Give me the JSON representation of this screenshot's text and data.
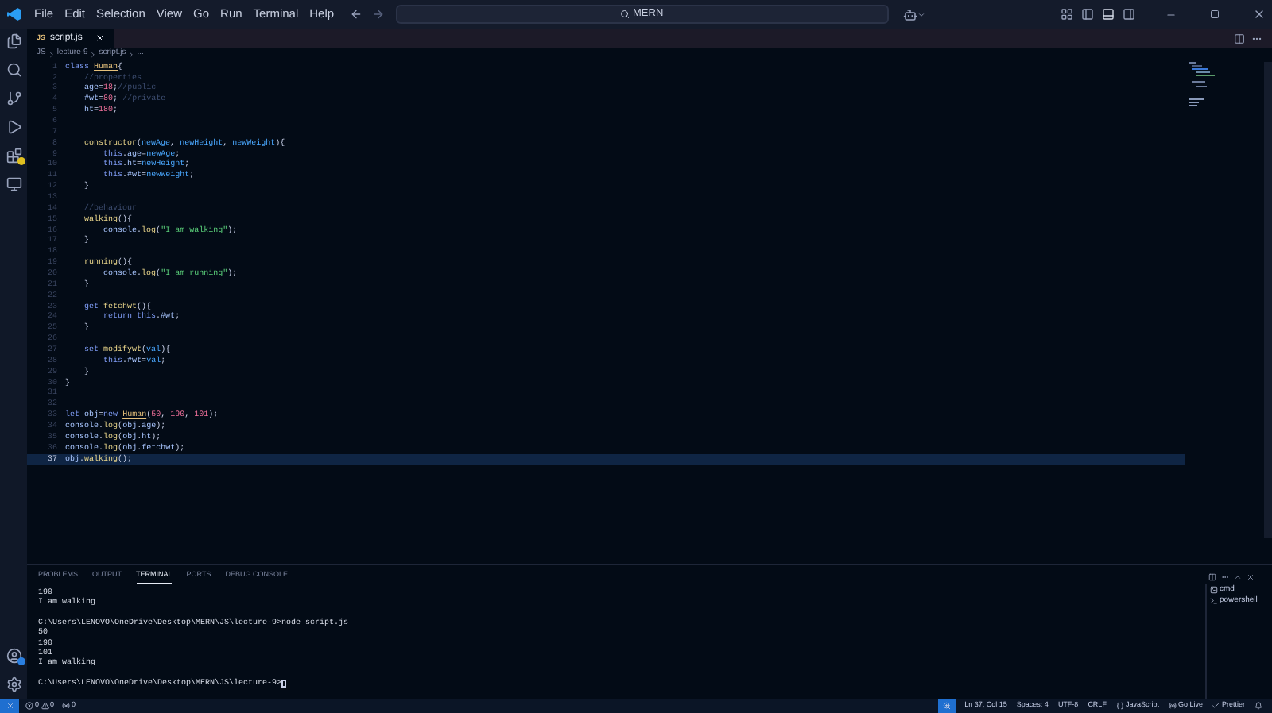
{
  "menu": [
    "File",
    "Edit",
    "Selection",
    "View",
    "Go",
    "Run",
    "Terminal",
    "Help"
  ],
  "search": {
    "value": "MERN"
  },
  "tabs": [
    {
      "icon": "JS",
      "label": "script.js",
      "selected": true
    }
  ],
  "breadcrumb": [
    "JS",
    "lecture-9",
    "script.js",
    "..."
  ],
  "editor": {
    "lines": [
      {
        "n": "1",
        "current": false,
        "tokens": [
          {
            "t": "class ",
            "kind": "keyword"
          },
          {
            "t": "Human",
            "kind": "classname"
          },
          {
            "t": "{",
            "kind": "punct"
          }
        ]
      },
      {
        "n": "2",
        "current": false,
        "tokens": [
          {
            "t": "    //properties",
            "kind": "comment"
          }
        ]
      },
      {
        "n": "3",
        "current": false,
        "tokens": [
          {
            "t": "    age",
            "kind": "variable"
          },
          {
            "t": "=",
            "kind": "punct"
          },
          {
            "t": "18",
            "kind": "number"
          },
          {
            "t": ";",
            "kind": "punct"
          },
          {
            "t": "//public",
            "kind": "comment"
          }
        ]
      },
      {
        "n": "4",
        "current": false,
        "tokens": [
          {
            "t": "    #wt",
            "kind": "variable"
          },
          {
            "t": "=",
            "kind": "punct"
          },
          {
            "t": "80",
            "kind": "number"
          },
          {
            "t": "; ",
            "kind": "punct"
          },
          {
            "t": "//private",
            "kind": "comment"
          }
        ]
      },
      {
        "n": "5",
        "current": false,
        "tokens": [
          {
            "t": "    ht",
            "kind": "variable"
          },
          {
            "t": "=",
            "kind": "punct"
          },
          {
            "t": "180",
            "kind": "number"
          },
          {
            "t": ";",
            "kind": "punct"
          }
        ]
      },
      {
        "n": "6",
        "current": false
      },
      {
        "n": "7",
        "current": false
      },
      {
        "n": "8",
        "current": false,
        "tokens": [
          {
            "t": "    constructor",
            "kind": "function"
          },
          {
            "t": "(",
            "kind": "punct"
          },
          {
            "t": "newAge",
            "kind": "param"
          },
          {
            "t": ", ",
            "kind": "punct"
          },
          {
            "t": "newHeight",
            "kind": "param"
          },
          {
            "t": ", ",
            "kind": "punct"
          },
          {
            "t": "newWeight",
            "kind": "param"
          },
          {
            "t": "){",
            "kind": "punct"
          }
        ]
      },
      {
        "n": "9",
        "current": false,
        "tokens": [
          {
            "t": "        this",
            "kind": "keyword"
          },
          {
            "t": ".",
            "kind": "punct"
          },
          {
            "t": "age",
            "kind": "variable"
          },
          {
            "t": "=",
            "kind": "punct"
          },
          {
            "t": "newAge",
            "kind": "param"
          },
          {
            "t": ";",
            "kind": "punct"
          }
        ]
      },
      {
        "n": "10",
        "current": false,
        "tokens": [
          {
            "t": "        this",
            "kind": "keyword"
          },
          {
            "t": ".",
            "kind": "punct"
          },
          {
            "t": "ht",
            "kind": "variable"
          },
          {
            "t": "=",
            "kind": "punct"
          },
          {
            "t": "newHeight",
            "kind": "param"
          },
          {
            "t": ";",
            "kind": "punct"
          }
        ]
      },
      {
        "n": "11",
        "current": false,
        "tokens": [
          {
            "t": "        this",
            "kind": "keyword"
          },
          {
            "t": ".",
            "kind": "punct"
          },
          {
            "t": "#wt",
            "kind": "variable"
          },
          {
            "t": "=",
            "kind": "punct"
          },
          {
            "t": "newWeight",
            "kind": "param"
          },
          {
            "t": ";",
            "kind": "punct"
          }
        ]
      },
      {
        "n": "12",
        "current": false,
        "tokens": [
          {
            "t": "    }",
            "kind": "punct"
          }
        ]
      },
      {
        "n": "13",
        "current": false
      },
      {
        "n": "14",
        "current": false,
        "tokens": [
          {
            "t": "    //behaviour",
            "kind": "comment"
          }
        ]
      },
      {
        "n": "15",
        "current": false,
        "tokens": [
          {
            "t": "    walking",
            "kind": "function"
          },
          {
            "t": "(){",
            "kind": "punct"
          }
        ]
      },
      {
        "n": "16",
        "current": false,
        "tokens": [
          {
            "t": "        console",
            "kind": "variable"
          },
          {
            "t": ".",
            "kind": "punct"
          },
          {
            "t": "log",
            "kind": "function"
          },
          {
            "t": "(",
            "kind": "punct"
          },
          {
            "t": "\"I am walking\"",
            "kind": "string"
          },
          {
            "t": ");",
            "kind": "punct"
          }
        ]
      },
      {
        "n": "17",
        "current": false,
        "tokens": [
          {
            "t": "    }",
            "kind": "punct"
          }
        ]
      },
      {
        "n": "18",
        "current": false
      },
      {
        "n": "19",
        "current": false,
        "tokens": [
          {
            "t": "    running",
            "kind": "function"
          },
          {
            "t": "(){",
            "kind": "punct"
          }
        ]
      },
      {
        "n": "20",
        "current": false,
        "tokens": [
          {
            "t": "        console",
            "kind": "variable"
          },
          {
            "t": ".",
            "kind": "punct"
          },
          {
            "t": "log",
            "kind": "function"
          },
          {
            "t": "(",
            "kind": "punct"
          },
          {
            "t": "\"I am running\"",
            "kind": "string"
          },
          {
            "t": ");",
            "kind": "punct"
          }
        ]
      },
      {
        "n": "21",
        "current": false,
        "tokens": [
          {
            "t": "    }",
            "kind": "punct"
          }
        ]
      },
      {
        "n": "22",
        "current": false
      },
      {
        "n": "23",
        "current": false,
        "tokens": [
          {
            "t": "    get ",
            "kind": "keyword"
          },
          {
            "t": "fetchwt",
            "kind": "function"
          },
          {
            "t": "(){",
            "kind": "punct"
          }
        ]
      },
      {
        "n": "24",
        "current": false,
        "tokens": [
          {
            "t": "        return ",
            "kind": "keyword"
          },
          {
            "t": "this",
            "kind": "keyword"
          },
          {
            "t": ".",
            "kind": "punct"
          },
          {
            "t": "#wt",
            "kind": "variable"
          },
          {
            "t": ";",
            "kind": "punct"
          }
        ]
      },
      {
        "n": "25",
        "current": false,
        "tokens": [
          {
            "t": "    }",
            "kind": "punct"
          }
        ]
      },
      {
        "n": "26",
        "current": false
      },
      {
        "n": "27",
        "current": false,
        "tokens": [
          {
            "t": "    set ",
            "kind": "keyword"
          },
          {
            "t": "modifywt",
            "kind": "function"
          },
          {
            "t": "(",
            "kind": "punct"
          },
          {
            "t": "val",
            "kind": "param"
          },
          {
            "t": "){",
            "kind": "punct"
          }
        ]
      },
      {
        "n": "28",
        "current": false,
        "tokens": [
          {
            "t": "        this",
            "kind": "keyword"
          },
          {
            "t": ".",
            "kind": "punct"
          },
          {
            "t": "#wt",
            "kind": "variable"
          },
          {
            "t": "=",
            "kind": "punct"
          },
          {
            "t": "val",
            "kind": "param"
          },
          {
            "t": ";",
            "kind": "punct"
          }
        ]
      },
      {
        "n": "29",
        "current": false,
        "tokens": [
          {
            "t": "    }",
            "kind": "punct"
          }
        ]
      },
      {
        "n": "30",
        "current": false,
        "tokens": [
          {
            "t": "}",
            "kind": "punct"
          }
        ]
      },
      {
        "n": "31",
        "current": false
      },
      {
        "n": "32",
        "current": false
      },
      {
        "n": "33",
        "current": false,
        "tokens": [
          {
            "t": "let ",
            "kind": "keyword"
          },
          {
            "t": "obj",
            "kind": "variable"
          },
          {
            "t": "=",
            "kind": "punct"
          },
          {
            "t": "new ",
            "kind": "keyword"
          },
          {
            "t": "Human",
            "kind": "classname"
          },
          {
            "t": "(",
            "kind": "punct"
          },
          {
            "t": "50",
            "kind": "number"
          },
          {
            "t": ", ",
            "kind": "punct"
          },
          {
            "t": "190",
            "kind": "number"
          },
          {
            "t": ", ",
            "kind": "punct"
          },
          {
            "t": "101",
            "kind": "number"
          },
          {
            "t": ");",
            "kind": "punct"
          }
        ]
      },
      {
        "n": "34",
        "current": false,
        "tokens": [
          {
            "t": "console",
            "kind": "variable"
          },
          {
            "t": ".",
            "kind": "punct"
          },
          {
            "t": "log",
            "kind": "function"
          },
          {
            "t": "(",
            "kind": "punct"
          },
          {
            "t": "obj",
            "kind": "variable"
          },
          {
            "t": ".",
            "kind": "punct"
          },
          {
            "t": "age",
            "kind": "variable"
          },
          {
            "t": ");",
            "kind": "punct"
          }
        ]
      },
      {
        "n": "35",
        "current": false,
        "tokens": [
          {
            "t": "console",
            "kind": "variable"
          },
          {
            "t": ".",
            "kind": "punct"
          },
          {
            "t": "log",
            "kind": "function"
          },
          {
            "t": "(",
            "kind": "punct"
          },
          {
            "t": "obj",
            "kind": "variable"
          },
          {
            "t": ".",
            "kind": "punct"
          },
          {
            "t": "ht",
            "kind": "variable"
          },
          {
            "t": ");",
            "kind": "punct"
          }
        ]
      },
      {
        "n": "36",
        "current": false,
        "tokens": [
          {
            "t": "console",
            "kind": "variable"
          },
          {
            "t": ".",
            "kind": "punct"
          },
          {
            "t": "log",
            "kind": "function"
          },
          {
            "t": "(",
            "kind": "punct"
          },
          {
            "t": "obj",
            "kind": "variable"
          },
          {
            "t": ".",
            "kind": "punct"
          },
          {
            "t": "fetchwt",
            "kind": "variable"
          },
          {
            "t": ");",
            "kind": "punct"
          }
        ]
      },
      {
        "n": "37",
        "current": true,
        "tokens": [
          {
            "t": "obj",
            "kind": "variable"
          },
          {
            "t": ".",
            "kind": "punct"
          },
          {
            "t": "walking",
            "kind": "function"
          },
          {
            "t": "();",
            "kind": "punct"
          }
        ]
      }
    ]
  },
  "panel": {
    "tabs": [
      {
        "label": "PROBLEMS",
        "selected": false
      },
      {
        "label": "OUTPUT",
        "selected": false
      },
      {
        "label": "TERMINAL",
        "selected": true
      },
      {
        "label": "PORTS",
        "selected": false
      },
      {
        "label": "DEBUG CONSOLE",
        "selected": false
      }
    ],
    "terminal_blocks": [
      [
        "190",
        "I am walking"
      ],
      [
        "C:\\Users\\LENOVO\\OneDrive\\Desktop\\MERN\\JS\\lecture-9>node script.js",
        "50",
        "190",
        "101",
        "I am walking"
      ],
      [
        "C:\\Users\\LENOVO\\OneDrive\\Desktop\\MERN\\JS\\lecture-9>"
      ]
    ],
    "terminals": [
      {
        "label": "cmd",
        "selected": false
      },
      {
        "label": "powershell",
        "selected": false
      }
    ]
  },
  "status_bar": {
    "errors": "0",
    "warnings": "0",
    "ports": "0",
    "right": [
      "Ln 37, Col 15",
      "Spaces: 4",
      "UTF-8",
      "CRLF",
      "JavaScript",
      "Go Live",
      "Prettier"
    ]
  }
}
